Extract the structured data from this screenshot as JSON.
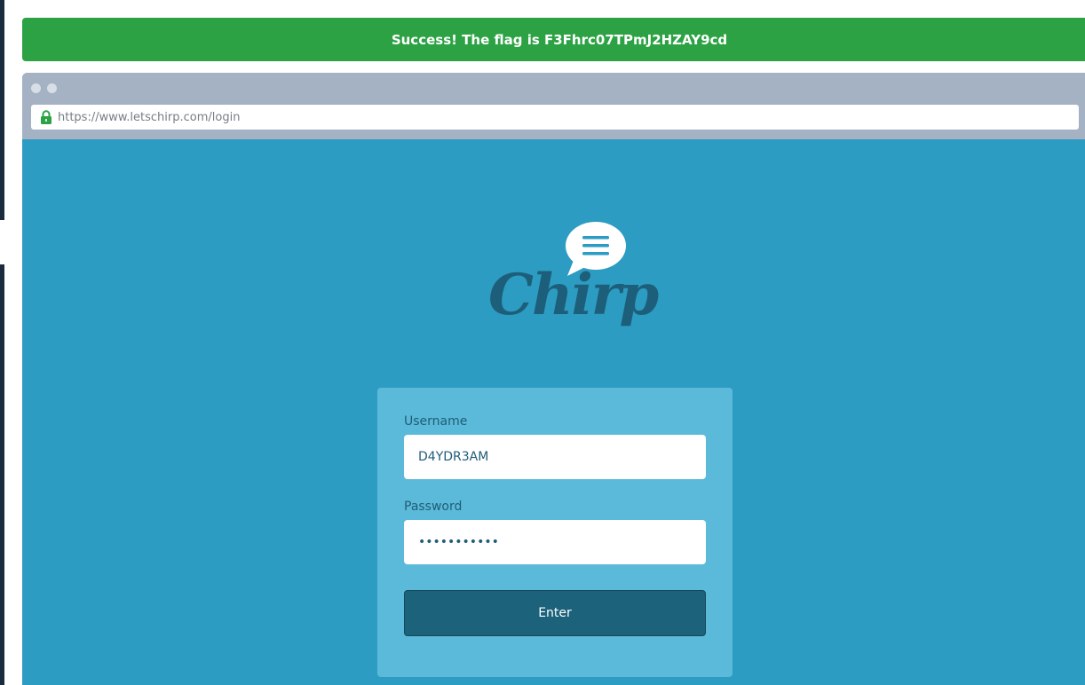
{
  "banner": {
    "message": "Success! The flag is F3Fhrc07TPmJ2HZAY9cd",
    "color": "#2ca244"
  },
  "browser": {
    "url": "https://www.letschirp.com/login",
    "lock_icon": "lock-icon"
  },
  "logo": {
    "text": "Chirp",
    "icon": "speech-bubble-icon"
  },
  "login_form": {
    "username_label": "Username",
    "username_value": "D4YDR3AM",
    "password_label": "Password",
    "password_value": "•••••••••••",
    "submit_label": "Enter"
  },
  "colors": {
    "page_bg": "#2d9cc2",
    "card_bg": "#5bbad9",
    "button_bg": "#1c627b",
    "logo_color": "#1d5f7a"
  }
}
